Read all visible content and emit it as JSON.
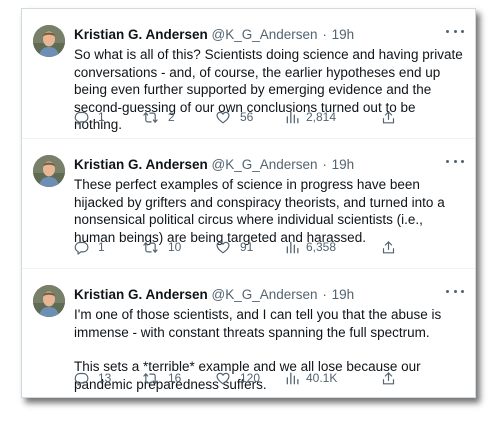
{
  "tweets": [
    {
      "name": "Kristian G. Andersen",
      "handle": "@K_G_Andersen",
      "separator": "·",
      "time": "19h",
      "paragraphs": [
        "So what is all of this? Scientists doing science and having private conversations - and, of course, the earlier hypotheses end up being even further supported by emerging evidence and the second-guessing of our own conclusions turned out to be nothing."
      ],
      "replies": "1",
      "retweets": "2",
      "likes": "56",
      "views": "2,814"
    },
    {
      "name": "Kristian G. Andersen",
      "handle": "@K_G_Andersen",
      "separator": "·",
      "time": "19h",
      "paragraphs": [
        "These perfect examples of science in progress have been hijacked by grifters and conspiracy theorists, and turned into a nonsensical political circus where individual scientists (i.e., human beings) are being targeted and harassed."
      ],
      "replies": "1",
      "retweets": "10",
      "likes": "91",
      "views": "6,358"
    },
    {
      "name": "Kristian G. Andersen",
      "handle": "@K_G_Andersen",
      "separator": "·",
      "time": "19h",
      "paragraphs": [
        "I'm one of those scientists, and I can tell you that the abuse is immense - with constant threats spanning the full spectrum.",
        "This sets a *terrible* example and we all lose because our pandemic preparedness suffers."
      ],
      "replies": "13",
      "retweets": "16",
      "likes": "120",
      "views": "40.1K"
    }
  ],
  "icons": {
    "reply": "reply-icon",
    "retweet": "retweet-icon",
    "like": "heart-icon",
    "views": "views-icon",
    "share": "share-icon",
    "more": "more-icon"
  },
  "colors": {
    "text": "#0f1419",
    "secondary": "#536471",
    "border": "#cfd9de"
  }
}
